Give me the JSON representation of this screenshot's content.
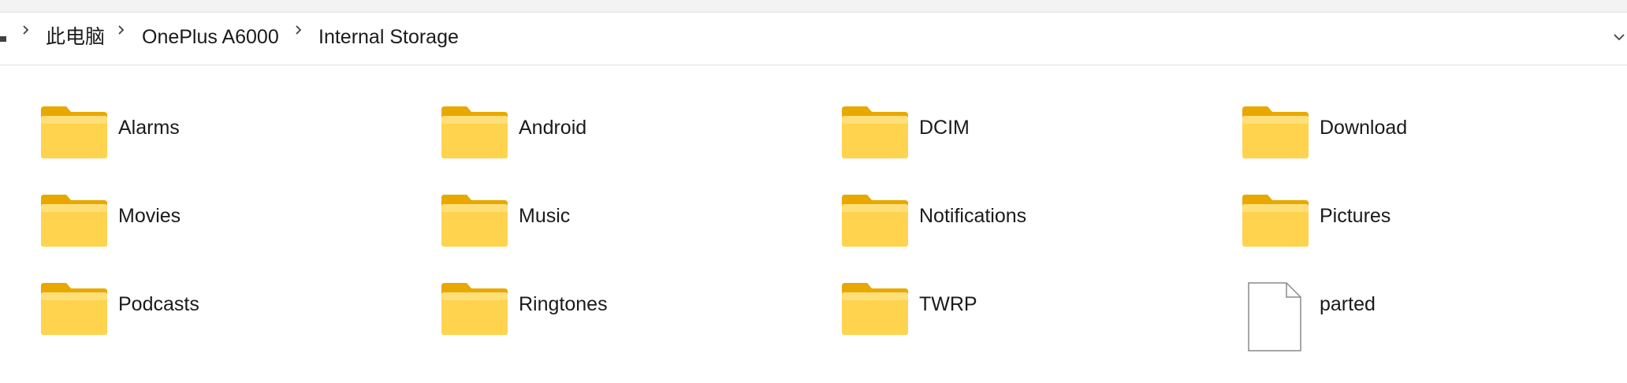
{
  "breadcrumb": {
    "items": [
      "此电脑",
      "OnePlus A6000",
      "Internal Storage"
    ],
    "separator_icon": "chevron-right-icon",
    "dropdown_icon": "chevron-down-icon"
  },
  "items": [
    {
      "name": "Alarms",
      "type": "folder"
    },
    {
      "name": "Android",
      "type": "folder"
    },
    {
      "name": "DCIM",
      "type": "folder"
    },
    {
      "name": "Download",
      "type": "folder"
    },
    {
      "name": "Movies",
      "type": "folder"
    },
    {
      "name": "Music",
      "type": "folder"
    },
    {
      "name": "Notifications",
      "type": "folder"
    },
    {
      "name": "Pictures",
      "type": "folder"
    },
    {
      "name": "Podcasts",
      "type": "folder"
    },
    {
      "name": "Ringtones",
      "type": "folder"
    },
    {
      "name": "TWRP",
      "type": "folder"
    },
    {
      "name": "parted",
      "type": "file"
    }
  ],
  "colors": {
    "folder_back": "#e8a800",
    "folder_front": "#ffd34e",
    "folder_front_light": "#ffe48c",
    "file_border": "#8a8a8a"
  }
}
